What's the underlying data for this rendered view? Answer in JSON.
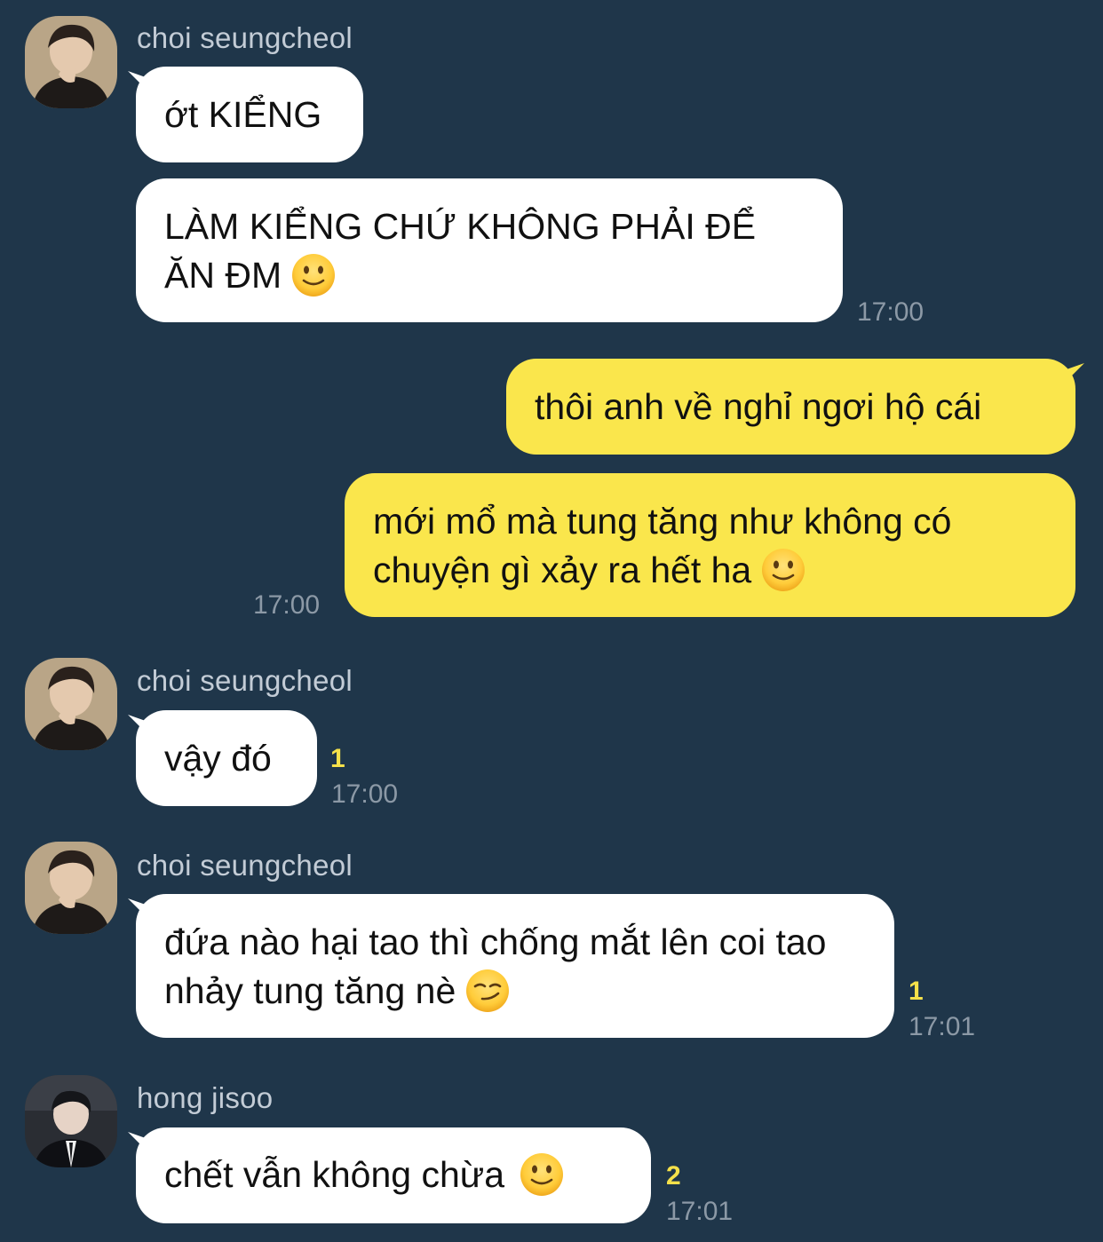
{
  "colors": {
    "background": "#1f364a",
    "incoming_bubble": "#ffffff",
    "outgoing_bubble": "#fae64c",
    "unread_count": "#f5e14a",
    "timestamp": "#8c99a6",
    "sender_name": "#c3ccd6"
  },
  "messages": [
    {
      "sender": "choi seungcheol",
      "text": "ớt KIỂNG"
    },
    {
      "text": "LÀM KIỂNG CHỨ KHÔNG PHẢI ĐỂ ĂN ĐM",
      "emoji": "slightly-smiling-face-icon",
      "time": "17:00"
    },
    {
      "text": "thôi anh về nghỉ ngơi hộ cái"
    },
    {
      "text": "mới mổ mà tung tăng như không có chuyện gì xảy ra hết ha",
      "emoji": "slightly-smiling-face-icon",
      "time": "17:00"
    },
    {
      "sender": "choi seungcheol",
      "text": "vậy đó",
      "unread": "1",
      "time": "17:00"
    },
    {
      "sender": "choi seungcheol",
      "text": "đứa nào hại tao thì chống mắt lên coi tao nhảy tung tăng nè",
      "emoji": "smirking-face-icon",
      "unread": "1",
      "time": "17:01"
    },
    {
      "sender": "hong jisoo",
      "text": "chết vẫn không chừa",
      "emoji": "slightly-smiling-face-icon",
      "unread": "2",
      "time": "17:01"
    }
  ]
}
